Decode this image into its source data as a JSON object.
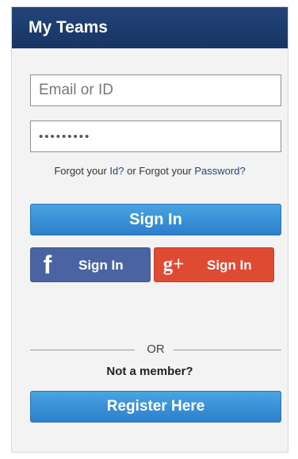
{
  "header": {
    "title": "My Teams"
  },
  "form": {
    "email_placeholder": "Email or ID",
    "password_value": "•••••••••",
    "forgot_prefix": "Forgot your ",
    "forgot_id_link": "Id?",
    "forgot_middle": " or Forgot your ",
    "forgot_password_link": "Password?",
    "signin_label": "Sign In"
  },
  "social": {
    "facebook_icon": "f",
    "facebook_label": "Sign In",
    "google_icon": "g+",
    "google_label": "Sign In"
  },
  "register": {
    "or_label": "OR",
    "not_member_label": "Not a member?",
    "register_label": "Register Here"
  },
  "colors": {
    "header_blue": "#173463",
    "primary_blue": "#2d7fcb",
    "facebook_blue": "#4a64a3",
    "google_red": "#df4a33"
  },
  "icons": {
    "facebook": "facebook-icon",
    "google": "google-plus-icon"
  }
}
